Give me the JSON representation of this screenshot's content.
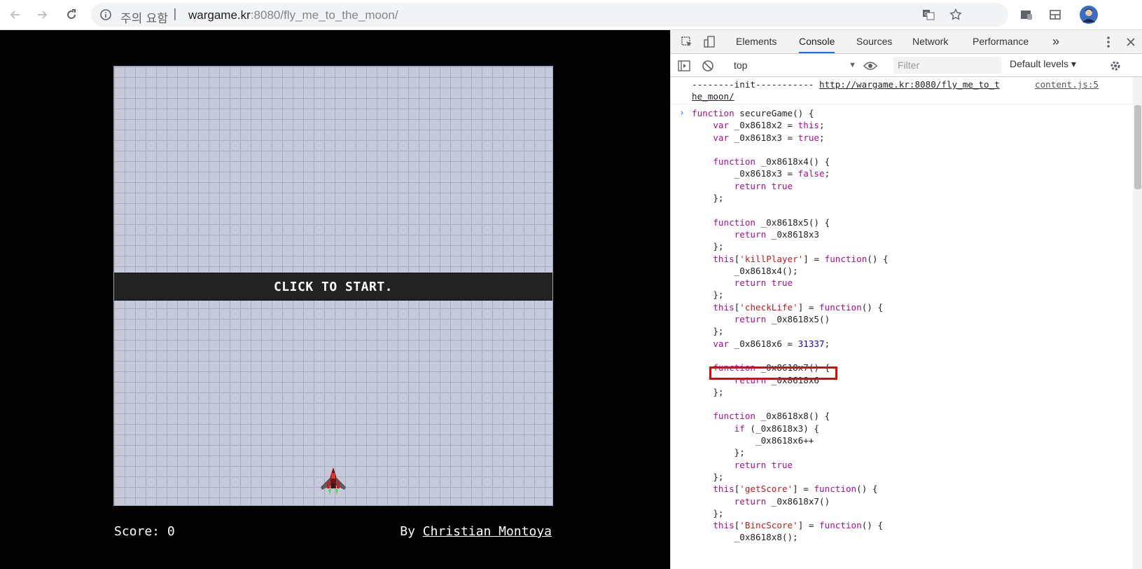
{
  "browser": {
    "security_label": "주의 요함",
    "separator": "|",
    "url_host": "wargame.kr",
    "url_rest": ":8080/fly_me_to_the_moon/"
  },
  "game": {
    "banner": "CLICK TO START.",
    "score_label": "Score: 0",
    "by_label": "By ",
    "author": "Christian Montoya"
  },
  "devtools": {
    "tabs": [
      "Elements",
      "Console",
      "Sources",
      "Network",
      "Performance"
    ],
    "more_tabs": "»",
    "context": "top",
    "filter_placeholder": "Filter",
    "levels": "Default levels ▾",
    "log": {
      "text": "--------init----------- ",
      "link": "http://wargame.kr:8080/fly_me_to_t",
      "link_wrap": "he_moon/",
      "source": "content.js:5"
    },
    "code_lines": [
      "function secureGame() {",
      "    var _0x8618x2 = this;",
      "    var _0x8618x3 = true;",
      "",
      "    function _0x8618x4() {",
      "        _0x8618x3 = false;",
      "        return true",
      "    };",
      "",
      "    function _0x8618x5() {",
      "        return _0x8618x3",
      "    };",
      "    this['killPlayer'] = function() {",
      "        _0x8618x4();",
      "        return true",
      "    };",
      "    this['checkLife'] = function() {",
      "        return _0x8618x5()",
      "    };",
      "    var _0x8618x6 = 31337;",
      "",
      "    function _0x8618x7() {",
      "        return _0x8618x6",
      "    };",
      "",
      "    function _0x8618x8() {",
      "        if (_0x8618x3) {",
      "            _0x8618x6++",
      "        };",
      "        return true",
      "    };",
      "    this['getScore'] = function() {",
      "        return _0x8618x7()",
      "    };",
      "    this['BincScore'] = function() {",
      "        _0x8618x8();"
    ]
  },
  "colors": {
    "accent": "#1a73e8",
    "highlight": "#e00000",
    "game_bg": "#000000",
    "grid": "#c6c9d9"
  }
}
